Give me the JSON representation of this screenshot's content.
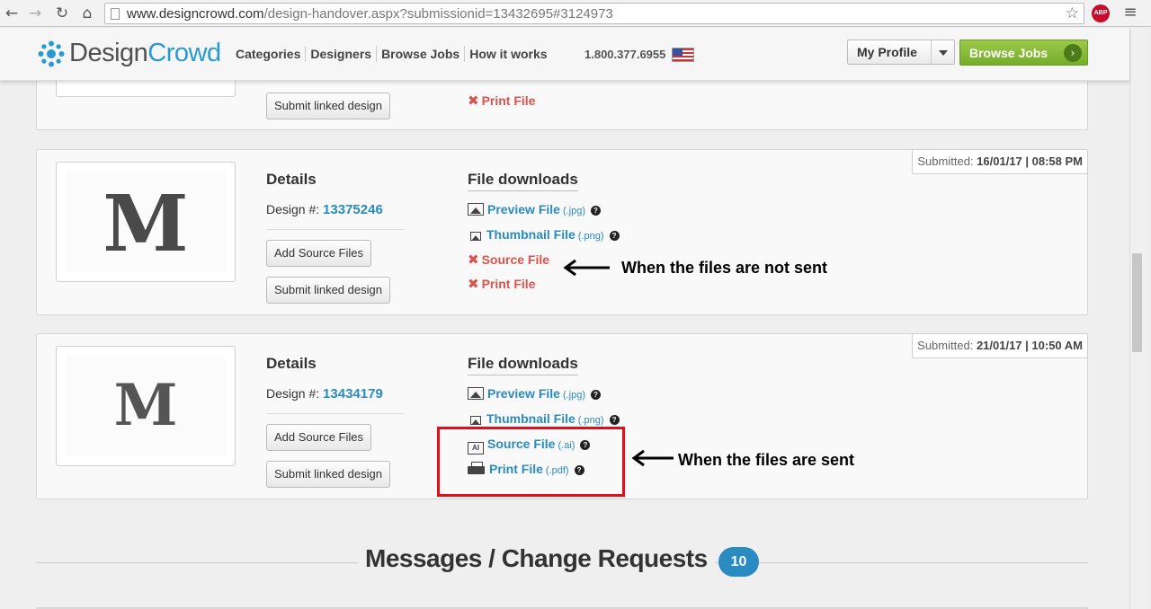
{
  "browser": {
    "url_host": "www.designcrowd.com",
    "url_path": "/design-handover.aspx?submissionid=13432695#3124973",
    "abp_label": "ABP"
  },
  "site": {
    "logo_design": "Design",
    "logo_crowd": "Crowd",
    "nav": [
      "Categories",
      "Designers",
      "Browse Jobs",
      "How it works"
    ],
    "phone": "1.800.377.6955",
    "profile_label": "My Profile",
    "browse_label": "Browse Jobs"
  },
  "panel_top": {
    "submit_linked": "Submit linked design",
    "print_file": "Print File"
  },
  "panel_mid": {
    "submitted_label": "Submitted:",
    "submitted_value": "16/01/17 | 08:58 PM",
    "thumb_letter": "M",
    "details_title": "Details",
    "design_label": "Design #:",
    "design_number": "13375246",
    "add_source": "Add Source Files",
    "submit_linked": "Submit linked design",
    "downloads_title": "File downloads",
    "preview": "Preview File",
    "preview_ext": "(.jpg)",
    "thumbnail": "Thumbnail File",
    "thumbnail_ext": "(.png)",
    "source": "Source File",
    "print": "Print File"
  },
  "panel_bottom": {
    "submitted_label": "Submitted:",
    "submitted_value": "21/01/17 | 10:50 AM",
    "thumb_letter": "M",
    "details_title": "Details",
    "design_label": "Design #:",
    "design_number": "13434179",
    "add_source": "Add Source Files",
    "submit_linked": "Submit linked design",
    "downloads_title": "File downloads",
    "preview": "Preview File",
    "preview_ext": "(.jpg)",
    "thumbnail": "Thumbnail File",
    "thumbnail_ext": "(.png)",
    "source": "Source File",
    "source_ext": "(.ai)",
    "print": "Print File",
    "print_ext": "(.pdf)"
  },
  "annotations": {
    "not_sent": "When the files are not sent",
    "sent": "When the files are sent"
  },
  "messages": {
    "title": "Messages / Change Requests",
    "count": "10"
  },
  "colors": {
    "link_blue": "#2a8bc0",
    "error_red": "#d9534f",
    "highlight_red": "#e0101a",
    "brand_green": "#76ad2a"
  }
}
